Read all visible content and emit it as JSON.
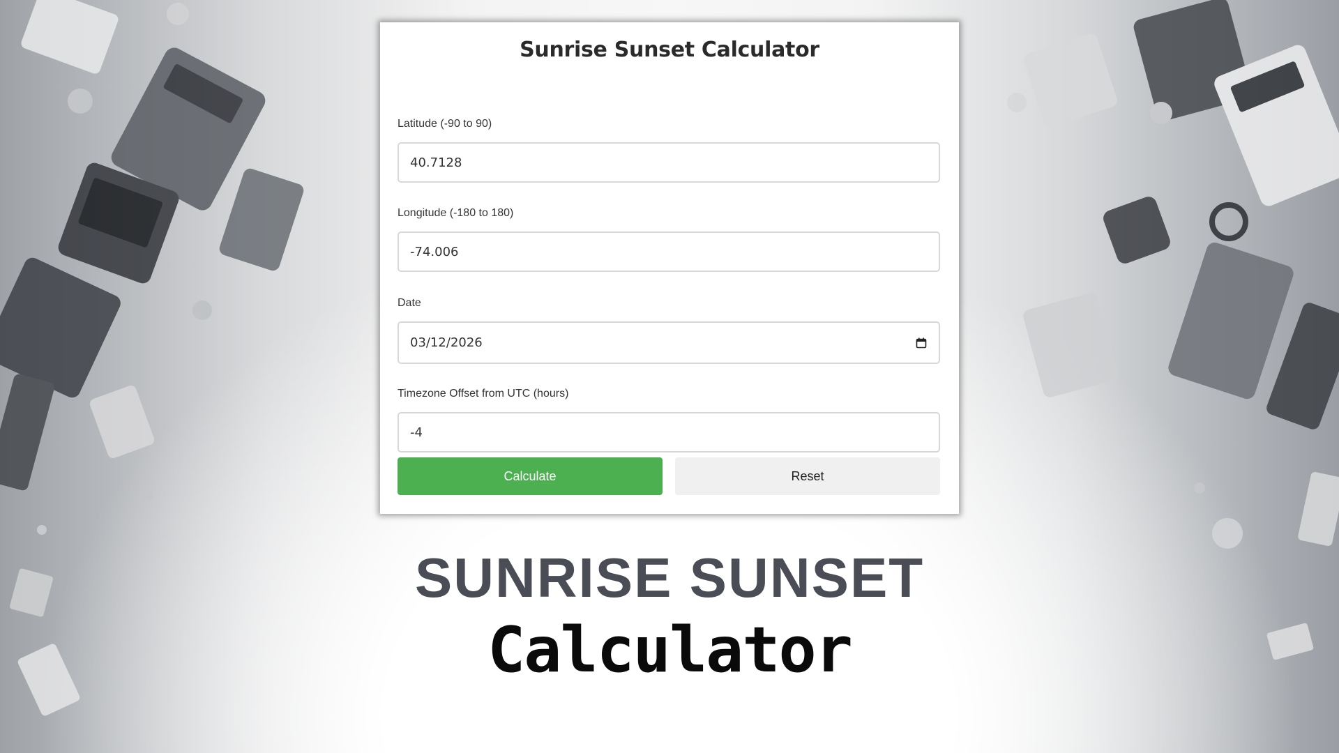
{
  "form": {
    "title": "Sunrise Sunset Calculator",
    "latitude": {
      "label": "Latitude (-90 to 90)",
      "value": "40.7128"
    },
    "longitude": {
      "label": "Longitude (-180 to 180)",
      "value": "-74.006"
    },
    "date": {
      "label": "Date",
      "value": "03/12/2026",
      "icon": "calendar-icon"
    },
    "timezone": {
      "label": "Timezone Offset from UTC (hours)",
      "value": "-4"
    },
    "calculate_label": "Calculate",
    "reset_label": "Reset"
  },
  "banner": {
    "line1": "SUNRISE SUNSET",
    "line2": "Calculator"
  },
  "colors": {
    "accent": "#4caf50",
    "reset_bg": "#f0f0f0",
    "headline": "#4a4d55"
  }
}
